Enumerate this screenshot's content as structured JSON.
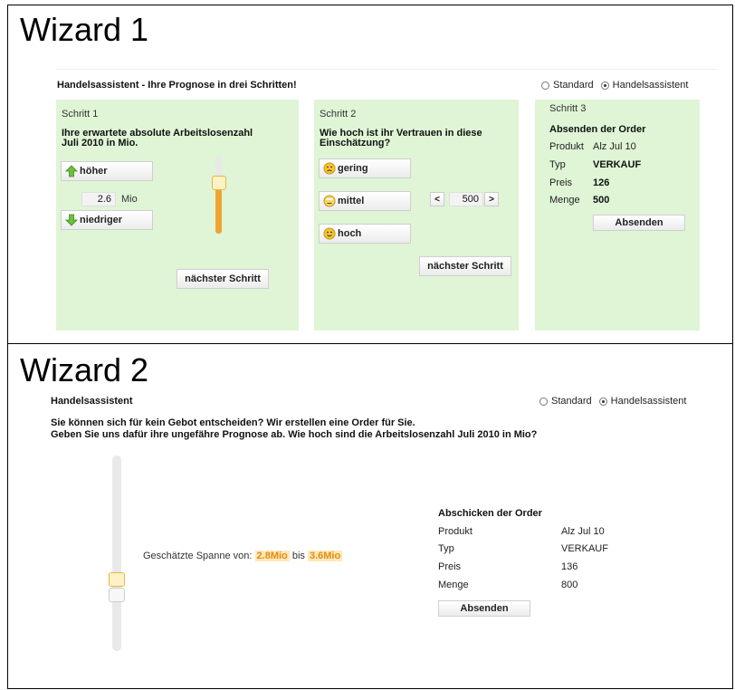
{
  "wizard1": {
    "title": "Wizard 1",
    "header": "Handelsassistent - Ihre Prognose in drei Schritten!",
    "mode_options": {
      "standard": "Standard",
      "assistant": "Handelsassistent",
      "selected": "assistant"
    },
    "step1": {
      "label": "Schritt 1",
      "question": "Ihre erwartete absolute Arbeitslosenzahl Juli 2010 in Mio.",
      "higher": "höher",
      "value": "2.6",
      "unit": "Mio",
      "lower": "niedriger",
      "next": "nächster Schritt",
      "slider_level": 0.7
    },
    "step2": {
      "label": "Schritt 2",
      "question": "Wie hoch ist ihr Vertrauen in diese Einschätzung?",
      "options": [
        "gering",
        "mittel",
        "hoch"
      ],
      "stepper_prev": "<",
      "stepper_value": "500",
      "stepper_next": ">",
      "next": "nächster Schritt"
    },
    "step3": {
      "label": "Schritt 3",
      "heading": "Absenden der Order",
      "rows": [
        {
          "key": "Produkt",
          "value": "Alz Jul 10"
        },
        {
          "key": "Typ",
          "value": "VERKAUF"
        },
        {
          "key": "Preis",
          "value": "126"
        },
        {
          "key": "Menge",
          "value": "500"
        }
      ],
      "submit": "Absenden"
    }
  },
  "wizard2": {
    "title": "Wizard 2",
    "header": "Handelsassistent",
    "mode_options": {
      "standard": "Standard",
      "assistant": "Handelsassistent",
      "selected": "assistant"
    },
    "intro_line1": "Sie können sich für kein Gebot entscheiden? Wir erstellen eine Order für Sie.",
    "intro_line2": "Geben Sie uns dafür ihre ungefähre Prognose ab. Wie hoch sind die Arbeitslosenzahl Juli 2010 in Mio?",
    "range_label": "Geschätzte Spanne von:",
    "range_from": "2.8Mio",
    "range_between": "bis",
    "range_to": "3.6Mio",
    "order": {
      "heading": "Abschicken der Order",
      "rows": [
        {
          "key": "Produkt",
          "value": "Alz Jul 10"
        },
        {
          "key": "Typ",
          "value": "VERKAUF"
        },
        {
          "key": "Preis",
          "value": "136"
        },
        {
          "key": "Menge",
          "value": "800"
        }
      ],
      "submit": "Absenden"
    }
  }
}
